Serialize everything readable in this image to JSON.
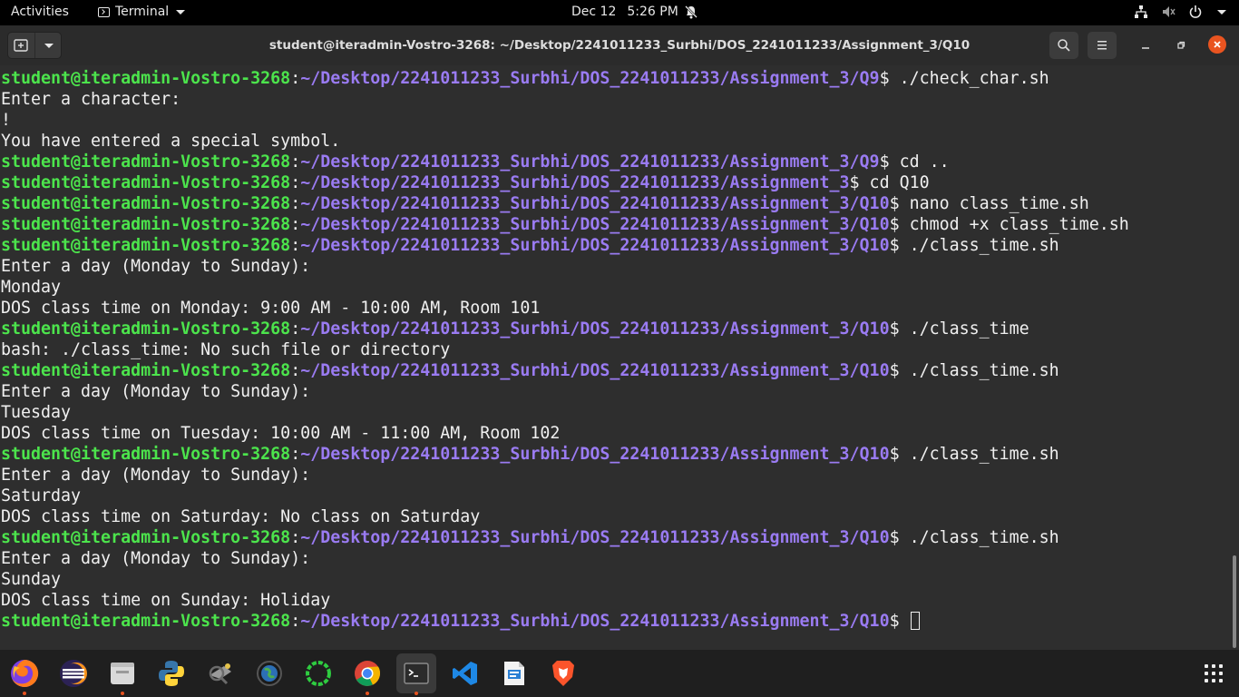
{
  "topbar": {
    "activities": "Activities",
    "app_name": "Terminal",
    "date": "Dec 12",
    "time": "5:26 PM"
  },
  "window": {
    "title": "student@iteradmin-Vostro-3268: ~/Desktop/2241011233_Surbhi/DOS_2241011233/Assignment_3/Q10"
  },
  "prompt": {
    "user": "student@iteradmin-Vostro-3268",
    "sep": ":"
  },
  "terminal": {
    "lines": [
      {
        "path": "~/Desktop/2241011233_Surbhi/DOS_2241011233/Assignment_3/Q9",
        "cmd": "$ ./check_char.sh"
      },
      {
        "text": "Enter a character:"
      },
      {
        "text": "!"
      },
      {
        "text": "You have entered a special symbol."
      },
      {
        "path": "~/Desktop/2241011233_Surbhi/DOS_2241011233/Assignment_3/Q9",
        "cmd": "$ cd .."
      },
      {
        "path": "~/Desktop/2241011233_Surbhi/DOS_2241011233/Assignment_3",
        "cmd": "$ cd Q10"
      },
      {
        "path": "~/Desktop/2241011233_Surbhi/DOS_2241011233/Assignment_3/Q10",
        "cmd": "$ nano class_time.sh"
      },
      {
        "path": "~/Desktop/2241011233_Surbhi/DOS_2241011233/Assignment_3/Q10",
        "cmd": "$ chmod +x class_time.sh"
      },
      {
        "path": "~/Desktop/2241011233_Surbhi/DOS_2241011233/Assignment_3/Q10",
        "cmd": "$ ./class_time.sh"
      },
      {
        "text": "Enter a day (Monday to Sunday):"
      },
      {
        "text": "Monday"
      },
      {
        "text": "DOS class time on Monday: 9:00 AM - 10:00 AM, Room 101"
      },
      {
        "path": "~/Desktop/2241011233_Surbhi/DOS_2241011233/Assignment_3/Q10",
        "cmd": "$ ./class_time"
      },
      {
        "text": "bash: ./class_time: No such file or directory"
      },
      {
        "path": "~/Desktop/2241011233_Surbhi/DOS_2241011233/Assignment_3/Q10",
        "cmd": "$ ./class_time.sh"
      },
      {
        "text": "Enter a day (Monday to Sunday):"
      },
      {
        "text": "Tuesday"
      },
      {
        "text": "DOS class time on Tuesday: 10:00 AM - 11:00 AM, Room 102"
      },
      {
        "path": "~/Desktop/2241011233_Surbhi/DOS_2241011233/Assignment_3/Q10",
        "cmd": "$ ./class_time.sh"
      },
      {
        "text": "Enter a day (Monday to Sunday):"
      },
      {
        "text": "Saturday"
      },
      {
        "text": "DOS class time on Saturday: No class on Saturday"
      },
      {
        "path": "~/Desktop/2241011233_Surbhi/DOS_2241011233/Assignment_3/Q10",
        "cmd": "$ ./class_time.sh"
      },
      {
        "text": "Enter a day (Monday to Sunday):"
      },
      {
        "text": "Sunday"
      },
      {
        "text": "DOS class time on Sunday: Holiday"
      },
      {
        "path": "~/Desktop/2241011233_Surbhi/DOS_2241011233/Assignment_3/Q10",
        "cmd": "$ ",
        "cursor": true
      }
    ]
  },
  "dock": {
    "apps": [
      {
        "icon": "firefox-icon",
        "running": true
      },
      {
        "icon": "eclipse-icon",
        "running": false
      },
      {
        "icon": "files-icon",
        "running": true
      },
      {
        "icon": "python-icon",
        "running": false
      },
      {
        "icon": "wireshark-icon",
        "running": false
      },
      {
        "icon": "globe-app-icon",
        "running": false
      },
      {
        "icon": "ring-app-icon",
        "running": false
      },
      {
        "icon": "chrome-icon",
        "running": true
      },
      {
        "icon": "terminal-icon",
        "running": true
      },
      {
        "icon": "vscode-icon",
        "running": false
      },
      {
        "icon": "text-editor-icon",
        "running": false
      },
      {
        "icon": "brave-icon",
        "running": false
      }
    ]
  },
  "colors": {
    "prompt_user": "#4ce44c",
    "prompt_path": "#9a7bf2",
    "terminal_bg": "#2e2e2e",
    "close_button": "#e95420"
  }
}
